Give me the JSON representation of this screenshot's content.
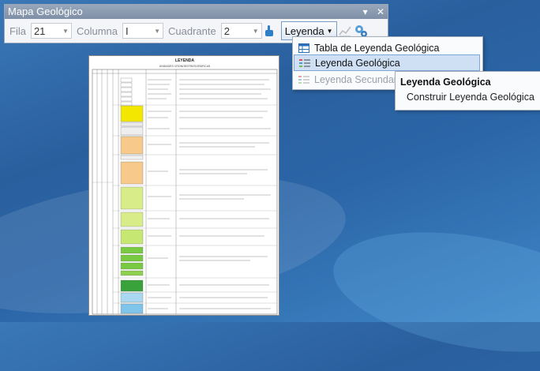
{
  "toolbar": {
    "title": "Mapa Geológico",
    "controls": [
      "▾",
      "✕"
    ],
    "fila_label": "Fila",
    "fila_value": "21",
    "columna_label": "Columna",
    "columna_value": "I",
    "cuadrante_label": "Cuadrante",
    "cuadrante_value": "2",
    "leyenda_label": "Leyenda"
  },
  "menu": {
    "items": [
      {
        "label": "Tabla de Leyenda Geológica",
        "icon": "table-icon"
      },
      {
        "label": "Leyenda Geológica",
        "icon": "legend-list-icon"
      },
      {
        "label": "Leyenda Secundaria",
        "icon": "legend-list-icon"
      }
    ]
  },
  "submenu": {
    "header": "Leyenda Geológica",
    "item": "Construir Leyenda Geológica"
  },
  "document": {
    "title": "LEYENDA",
    "subtitle": "UNIDADES CRONOESTRATIGRÁFICAS"
  },
  "colors": {
    "yellow_unit": "#f3e700",
    "orange_unit": "#f7c98a",
    "lime_unit": "#d8ec8a",
    "green_unit": "#7ac943",
    "dark_green_unit": "#3aa23a",
    "light_blue_unit": "#a9d8f0",
    "blue_unit": "#7fc4ea"
  }
}
